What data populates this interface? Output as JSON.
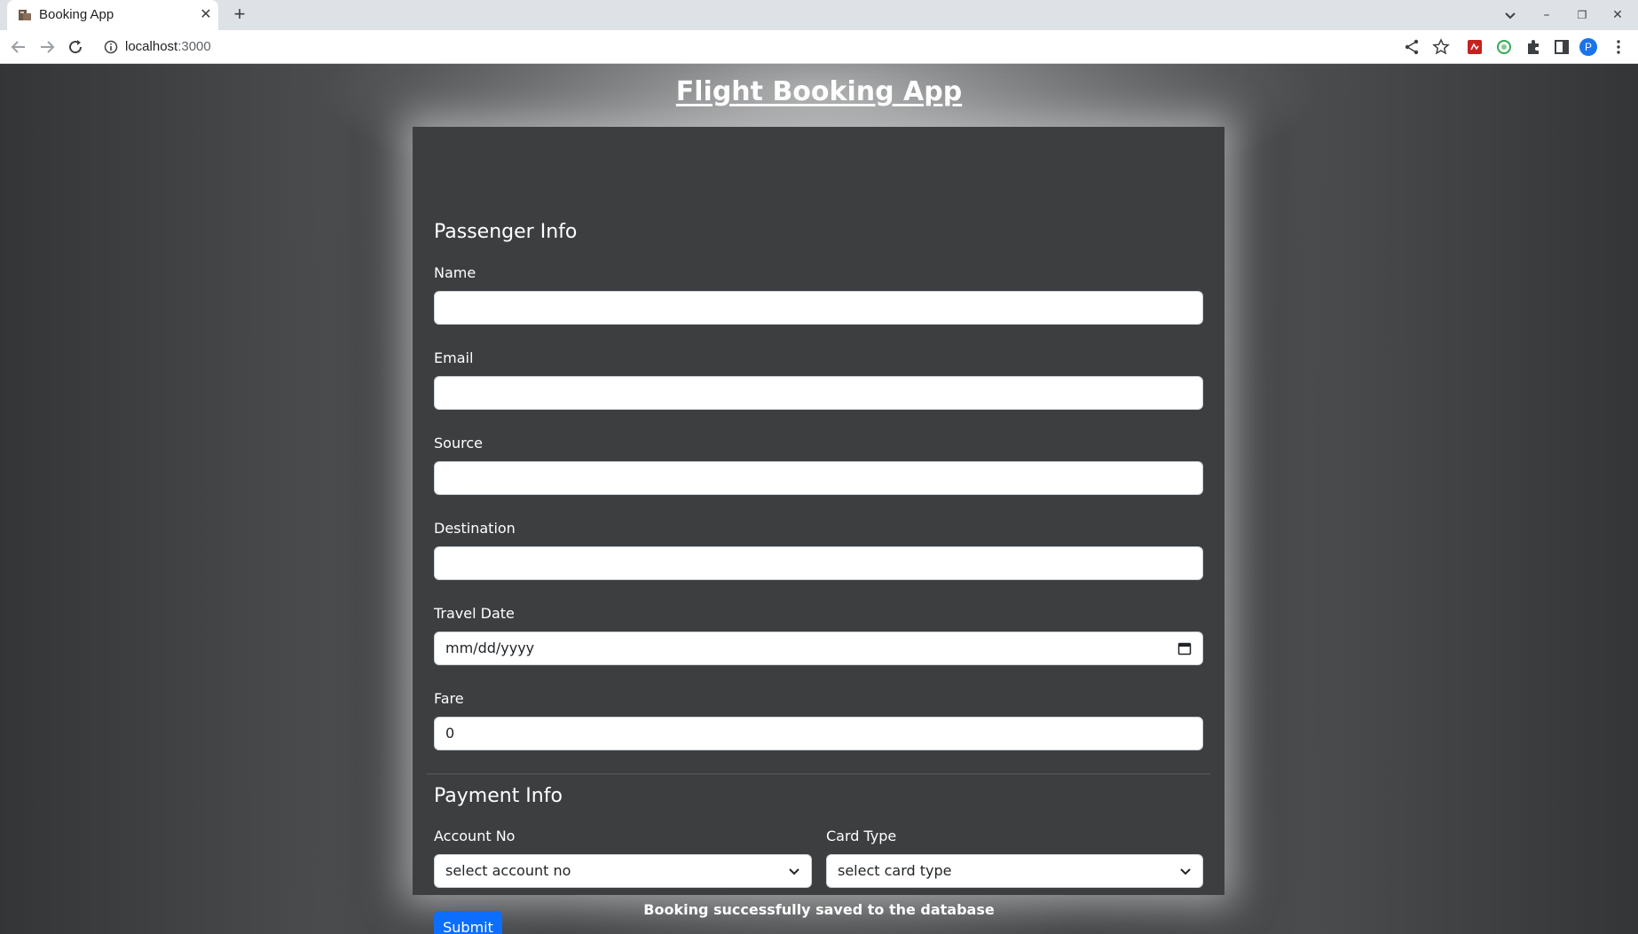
{
  "browser": {
    "tab_title": "Booking App",
    "url_host": "localhost",
    "url_port": ":3000",
    "avatar_letter": "P"
  },
  "page": {
    "app_title": "Flight Booking App",
    "passenger_section": "Passenger Info",
    "payment_section": "Payment Info",
    "fields": {
      "name_label": "Name",
      "name_value": "",
      "email_label": "Email",
      "email_value": "",
      "source_label": "Source",
      "source_value": "",
      "destination_label": "Destination",
      "destination_value": "",
      "travel_date_label": "Travel Date",
      "travel_date_placeholder": "mm/dd/yyyy",
      "fare_label": "Fare",
      "fare_value": "0"
    },
    "payment": {
      "account_label": "Account No",
      "account_selected": "select account no",
      "card_label": "Card Type",
      "card_selected": "select card type"
    },
    "submit_label": "Submit",
    "status_message": "Booking successfully saved to the database"
  },
  "colors": {
    "primary_button": "#0d6efd",
    "avatar": "#1a73e8"
  }
}
